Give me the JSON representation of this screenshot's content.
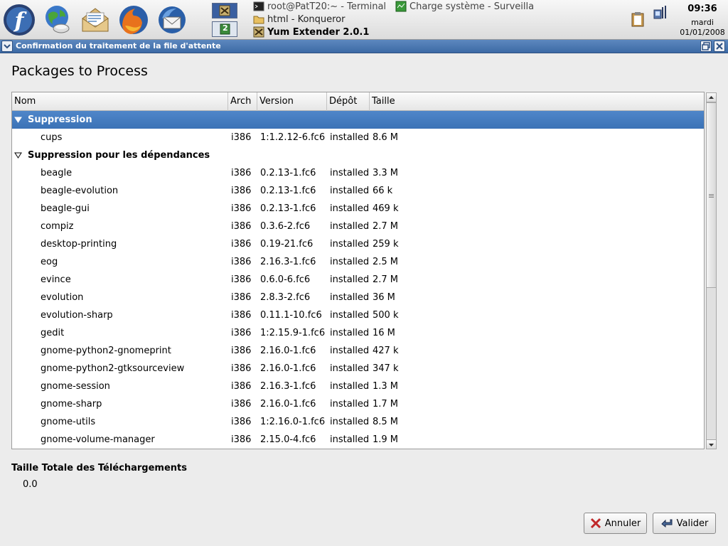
{
  "panel": {
    "launchers": [
      {
        "name": "fedora-menu-icon"
      },
      {
        "name": "network-globe-icon"
      },
      {
        "name": "mail-envelope-icon"
      },
      {
        "name": "firefox-icon"
      },
      {
        "name": "thunderbird-icon"
      }
    ],
    "pager": {
      "workspace_2_label": "2"
    },
    "tasks": [
      {
        "label": "root@PatT20:~ - Terminal",
        "icon": "terminal-icon"
      },
      {
        "label": "Charge système - Surveilla",
        "icon": "system-monitor-icon"
      },
      {
        "label": "html - Konqueror",
        "icon": "folder-icon"
      },
      {
        "label": "Yum Extender 2.0.1",
        "icon": "yum-extender-icon",
        "active": true
      }
    ],
    "clock": {
      "time": "09:36",
      "day": "mardi",
      "date": "01/01/2008"
    }
  },
  "dialog": {
    "title": "Confirmation du traitement de la file d'attente",
    "heading": "Packages to Process",
    "columns": {
      "name": "Nom",
      "arch": "Arch",
      "version": "Version",
      "repo": "Dépôt",
      "size": "Taille"
    },
    "groups": [
      {
        "label": "Suppression",
        "selected": true,
        "items": [
          {
            "name": "cups",
            "arch": "i386",
            "version": "1:1.2.12-6.fc6",
            "repo": "installed",
            "size": "8.6 M"
          }
        ]
      },
      {
        "label": "Suppression pour les dépendances",
        "selected": false,
        "items": [
          {
            "name": "beagle",
            "arch": "i386",
            "version": "0.2.13-1.fc6",
            "repo": "installed",
            "size": "3.3 M"
          },
          {
            "name": "beagle-evolution",
            "arch": "i386",
            "version": "0.2.13-1.fc6",
            "repo": "installed",
            "size": "66 k"
          },
          {
            "name": "beagle-gui",
            "arch": "i386",
            "version": "0.2.13-1.fc6",
            "repo": "installed",
            "size": "469 k"
          },
          {
            "name": "compiz",
            "arch": "i386",
            "version": "0.3.6-2.fc6",
            "repo": "installed",
            "size": "2.7 M"
          },
          {
            "name": "desktop-printing",
            "arch": "i386",
            "version": "0.19-21.fc6",
            "repo": "installed",
            "size": "259 k"
          },
          {
            "name": "eog",
            "arch": "i386",
            "version": "2.16.3-1.fc6",
            "repo": "installed",
            "size": "2.5 M"
          },
          {
            "name": "evince",
            "arch": "i386",
            "version": "0.6.0-6.fc6",
            "repo": "installed",
            "size": "2.7 M"
          },
          {
            "name": "evolution",
            "arch": "i386",
            "version": "2.8.3-2.fc6",
            "repo": "installed",
            "size": "36 M"
          },
          {
            "name": "evolution-sharp",
            "arch": "i386",
            "version": "0.11.1-10.fc6",
            "repo": "installed",
            "size": "500 k"
          },
          {
            "name": "gedit",
            "arch": "i386",
            "version": "1:2.15.9-1.fc6",
            "repo": "installed",
            "size": "16 M"
          },
          {
            "name": "gnome-python2-gnomeprint",
            "arch": "i386",
            "version": "2.16.0-1.fc6",
            "repo": "installed",
            "size": "427 k"
          },
          {
            "name": "gnome-python2-gtksourceview",
            "arch": "i386",
            "version": "2.16.0-1.fc6",
            "repo": "installed",
            "size": "347 k"
          },
          {
            "name": "gnome-session",
            "arch": "i386",
            "version": "2.16.3-1.fc6",
            "repo": "installed",
            "size": "1.3 M"
          },
          {
            "name": "gnome-sharp",
            "arch": "i386",
            "version": "2.16.0-1.fc6",
            "repo": "installed",
            "size": "1.7 M"
          },
          {
            "name": "gnome-utils",
            "arch": "i386",
            "version": "1:2.16.0-1.fc6",
            "repo": "installed",
            "size": "8.5 M"
          },
          {
            "name": "gnome-volume-manager",
            "arch": "i386",
            "version": "2.15.0-4.fc6",
            "repo": "installed",
            "size": "1.9 M"
          }
        ]
      }
    ],
    "scroll": {
      "position_fraction": 0.0,
      "visible_fraction": 0.55
    },
    "total": {
      "label": "Taille Totale des Téléchargements",
      "value": "0.0"
    },
    "buttons": {
      "cancel_label": "Annuler",
      "ok_label": "Valider"
    }
  }
}
